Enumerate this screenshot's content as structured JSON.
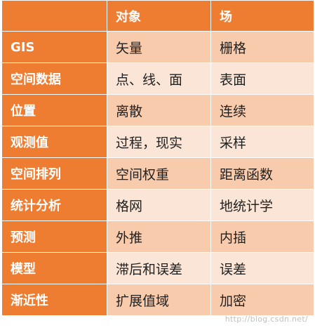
{
  "table": {
    "headers": [
      "",
      "对象",
      "场"
    ],
    "rows": [
      {
        "label": "GIS",
        "object": "矢量",
        "field": "栅格"
      },
      {
        "label": "空间数据",
        "object": "点、线、面",
        "field": "表面"
      },
      {
        "label": "位置",
        "object": "离散",
        "field": "连续"
      },
      {
        "label": "观测值",
        "object": "过程，现实",
        "field": "采样"
      },
      {
        "label": "空间排列",
        "object": "空间权重",
        "field": "距离函数"
      },
      {
        "label": "统计分析",
        "object": "格网",
        "field": "地统计学"
      },
      {
        "label": "预测",
        "object": "外推",
        "field": "内插"
      },
      {
        "label": "模型",
        "object": "滞后和误差",
        "field": "误差"
      },
      {
        "label": "渐近性",
        "object": "扩展值域",
        "field": "加密"
      }
    ]
  },
  "colors": {
    "header_orange": "#ee7d31",
    "row_dark": "#f8cbad",
    "row_light": "#fbe5d6"
  },
  "watermark": "http://blog.csdn.net/"
}
